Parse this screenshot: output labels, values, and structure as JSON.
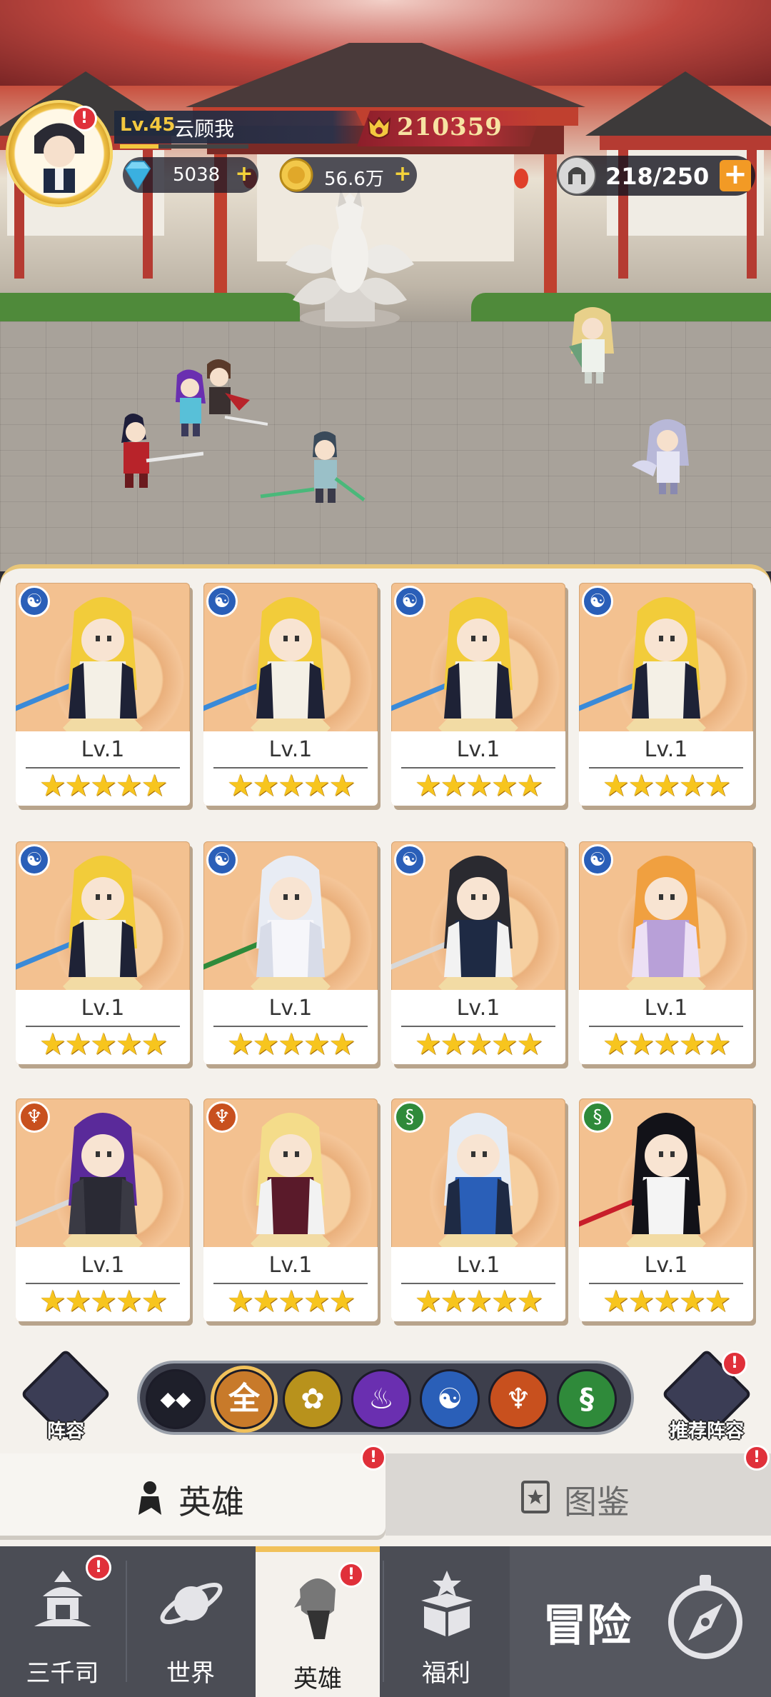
{
  "player": {
    "level": "Lv.45",
    "name": "云顾我",
    "xp_progress": 0.3,
    "power": "210359",
    "gems": "5038",
    "gold": "56.6万",
    "stamina": "218/250"
  },
  "heroes": [
    {
      "level": "Lv.1",
      "stars": 5,
      "faction": "water",
      "sprite": "golden-knight"
    },
    {
      "level": "Lv.1",
      "stars": 5,
      "faction": "water",
      "sprite": "golden-knight"
    },
    {
      "level": "Lv.1",
      "stars": 5,
      "faction": "water",
      "sprite": "golden-knight"
    },
    {
      "level": "Lv.1",
      "stars": 5,
      "faction": "water",
      "sprite": "golden-knight"
    },
    {
      "level": "Lv.1",
      "stars": 5,
      "faction": "water",
      "sprite": "golden-knight"
    },
    {
      "level": "Lv.1",
      "stars": 5,
      "faction": "water",
      "sprite": "white-fox-girl"
    },
    {
      "level": "Lv.1",
      "stars": 5,
      "faction": "water",
      "sprite": "dark-swordsman"
    },
    {
      "level": "Lv.1",
      "stars": 5,
      "faction": "water",
      "sprite": "orange-hair-girl"
    },
    {
      "level": "Lv.1",
      "stars": 5,
      "faction": "meditate",
      "sprite": "purple-swordswoman"
    },
    {
      "level": "Lv.1",
      "stars": 5,
      "faction": "meditate",
      "sprite": "blonde-girl"
    },
    {
      "level": "Lv.1",
      "stars": 5,
      "faction": "dna",
      "sprite": "silver-twintail"
    },
    {
      "level": "Lv.1",
      "stars": 5,
      "faction": "dna",
      "sprite": "black-hair-girl"
    }
  ],
  "filters": {
    "lineup_label": "阵容",
    "recommend_label": "推荐阵容",
    "items": [
      {
        "name": "diamond-filter",
        "glyph": "",
        "color": "#1e1f2a"
      },
      {
        "name": "all-filter",
        "glyph": "全",
        "color": "#c87a2a"
      },
      {
        "name": "lotus-filter",
        "glyph": "",
        "color": "#b8921c"
      },
      {
        "name": "flame-filter",
        "glyph": "",
        "color": "#6a2fb0"
      },
      {
        "name": "water-filter",
        "glyph": "",
        "color": "#2a5fb8"
      },
      {
        "name": "meditate-filter",
        "glyph": "",
        "color": "#c8501e"
      },
      {
        "name": "dna-filter",
        "glyph": "",
        "color": "#2f8a3a"
      }
    ]
  },
  "tabs": {
    "heroes": "英雄",
    "codex": "图鉴"
  },
  "nav": {
    "sanqiansi": "三千司",
    "world": "世界",
    "heroes": "英雄",
    "welfare": "福利",
    "adventure": "冒险"
  },
  "colors": {
    "water": "#2a5fb8",
    "meditate": "#c8501e",
    "dna": "#2f8a3a",
    "accent": "#f1c15a",
    "alert": "#e0303a"
  }
}
